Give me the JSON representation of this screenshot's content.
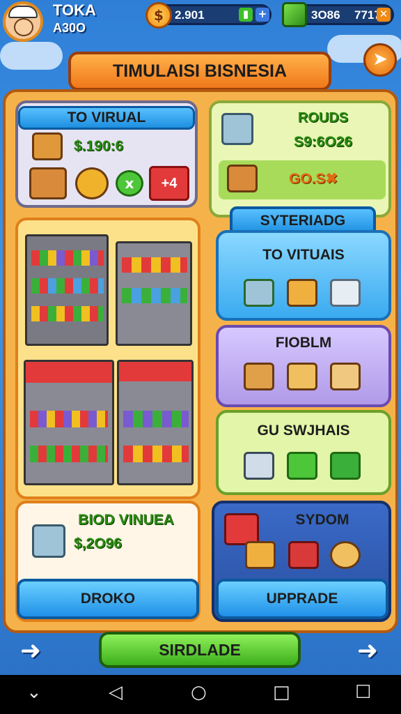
{
  "player": {
    "name": "TOKA",
    "level_text": "A30O"
  },
  "resources": {
    "coins": {
      "value": "2.901",
      "icon": "coin-icon",
      "icon_glyph": "$"
    },
    "gems": {
      "value": "3O86",
      "extra": "7717",
      "icon": "gem-icon"
    }
  },
  "title": "TIMULAISI BISNESIA",
  "panels": {
    "to_virual": {
      "label": "TO VIRUAL",
      "amount": "$.190:6",
      "action_x": "x",
      "action_plus": "+4"
    },
    "rouds": {
      "label": "ROUDS",
      "amount": "S9:6O26",
      "badge": "GO.S"
    },
    "syteriadg": {
      "label": "SYTERIADG"
    },
    "to_vituais": {
      "label": "TO VITUAIS"
    },
    "fiobum": {
      "label": "FIOBLM"
    },
    "gu_swjhais": {
      "label": "GU SWJHAIS"
    },
    "biod_vinuea": {
      "label": "BIOD VINUEA",
      "amount": "$,2O96",
      "button": "DROKO"
    },
    "sydom": {
      "label": "SYDOM",
      "button": "UPPRADE"
    }
  },
  "bottom": {
    "main_button": "SIRDLADE"
  },
  "colors": {
    "accent_orange": "#f0781a",
    "panel_orange": "#f6b24a",
    "money_green": "#2a8a10",
    "button_blue": "#2aa0ee",
    "button_green": "#3bae1b"
  }
}
